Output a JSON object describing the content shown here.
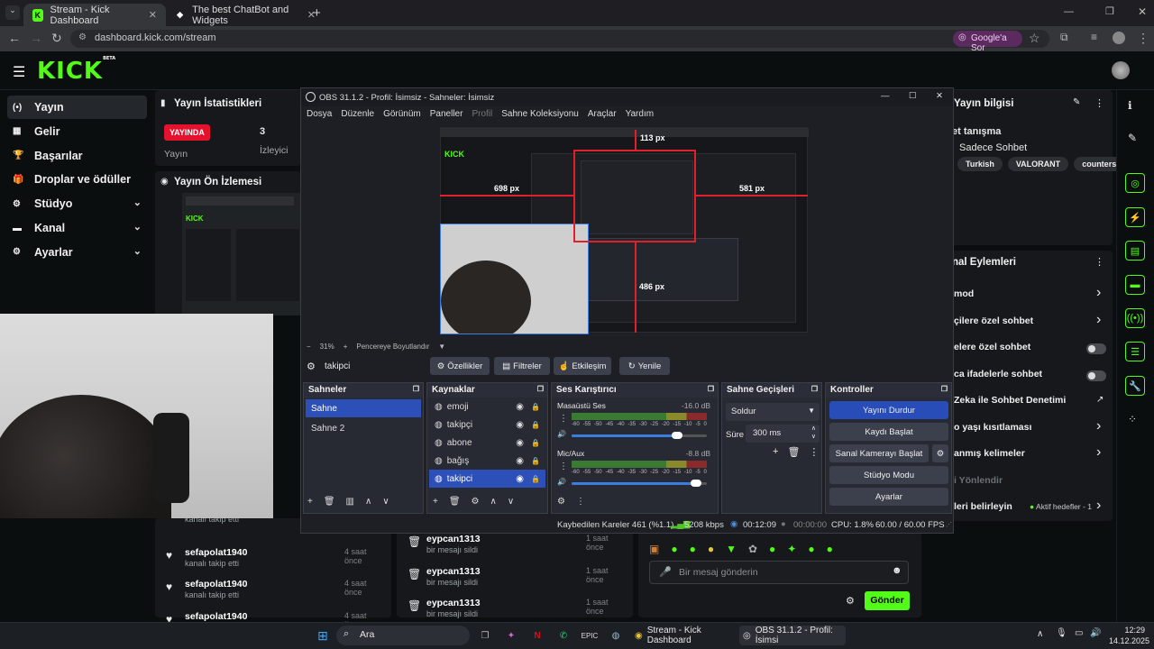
{
  "browser": {
    "tabs": [
      {
        "title": "Stream - Kick Dashboard",
        "active": true
      },
      {
        "title": "The best ChatBot and Widgets",
        "active": false
      }
    ],
    "url": "dashboard.kick.com/stream",
    "google_btn": "Google'a Sor"
  },
  "kick": {
    "logo": "KICK",
    "logo_sup": "BETA",
    "sidebar": [
      {
        "label": "Yayın",
        "icon": "broadcast-icon",
        "active": true,
        "expand": false
      },
      {
        "label": "Gelir",
        "icon": "money-icon",
        "active": false,
        "expand": false
      },
      {
        "label": "Başarılar",
        "icon": "trophy-icon",
        "active": false,
        "expand": false
      },
      {
        "label": "Droplar ve ödüller",
        "icon": "gift-icon",
        "active": false,
        "expand": false
      },
      {
        "label": "Stüdyo",
        "icon": "gear-icon",
        "active": false,
        "expand": true
      },
      {
        "label": "Kanal",
        "icon": "chat-icon",
        "active": false,
        "expand": true
      },
      {
        "label": "Ayarlar",
        "icon": "cog-icon",
        "active": false,
        "expand": true
      }
    ],
    "stats": {
      "title": "Yayın İstatistikleri",
      "live_badge": "YAYINDA",
      "live_label": "Yayın",
      "viewers_value": "3",
      "viewers_label": "İzleyici"
    },
    "preview_title": "Yayın Ön İzlemesi",
    "info_title": "Yayın bilgisi",
    "info_intro": "et tanışma",
    "info_category": "Sadece Sohbet",
    "tags": [
      "Turkish",
      "VALORANT",
      "counterstrike"
    ],
    "actions_title": "nal Eylemleri",
    "actions": [
      {
        "label": "mod",
        "control": "arrow"
      },
      {
        "label": "çilere özel sohbet",
        "control": "arrow"
      },
      {
        "label": "elere özel sohbet",
        "control": "toggle"
      },
      {
        "label": "ca ifadelerle sohbet",
        "control": "toggle"
      },
      {
        "label": "Zeka ile Sohbet Denetimi",
        "control": "link"
      },
      {
        "label": "o yaşı kısıtlaması",
        "control": "arrow"
      },
      {
        "label": "anmış kelimeler",
        "control": "arrow"
      },
      {
        "label": "i Yönlendir",
        "control": "none"
      },
      {
        "label": "leri belirleyin",
        "control": "arrow",
        "extra": "Aktif hedefler - 1"
      }
    ],
    "feed_left": [
      {
        "name": "kanalı takip etti",
        "time": ""
      },
      {
        "name": "sefapolat1940",
        "sub": "kanalı takip etti",
        "time": "4 saat önce"
      },
      {
        "name": "sefapolat1940",
        "sub": "kanalı takip etti",
        "time": "4 saat önce"
      },
      {
        "name": "sefapolat1940",
        "sub": "kanalı takip etti",
        "time": "4 saat önce"
      }
    ],
    "feed_mid": [
      {
        "name": "eypcan1313",
        "sub": "bir mesajı sildi",
        "time": "1 saat önce"
      },
      {
        "name": "eypcan1313",
        "sub": "bir mesajı sildi",
        "time": "1 saat önce"
      },
      {
        "name": "eypcan1313",
        "sub": "bir mesajı sildi",
        "time": "1 saat önce"
      }
    ],
    "chat_placeholder": "Bir mesaj gönderin",
    "send_label": "Gönder"
  },
  "obs": {
    "title": "OBS 31.1.2 - Profil: İsimsiz - Sahneler: İsimsiz",
    "menu": [
      "Dosya",
      "Düzenle",
      "Görünüm",
      "Paneller",
      "Profil",
      "Sahne Koleksiyonu",
      "Araçlar",
      "Yardım"
    ],
    "measures": [
      "113 px",
      "698 px",
      "581 px",
      "486 px"
    ],
    "zoom": "31%",
    "fit_label": "Pencereye Boyutlandır",
    "source_name": "takipci",
    "toolbar": [
      "Özellikler",
      "Filtreler",
      "Etkileşim",
      "Yenile"
    ],
    "scenes_title": "Sahneler",
    "scenes": [
      "Sahne",
      "Sahne 2"
    ],
    "sources_title": "Kaynaklar",
    "sources": [
      "emoji",
      "takipçi",
      "abone",
      "bağış",
      "takipci"
    ],
    "mixer_title": "Ses Karıştırıcı",
    "mixer": [
      {
        "name": "Masaüstü Ses",
        "db": "-16.0 dB",
        "level": 0.78
      },
      {
        "name": "Mic/Aux",
        "db": "-8.8 dB",
        "level": 0.92
      }
    ],
    "meter_ticks": [
      "-60",
      "-55",
      "-50",
      "-45",
      "-40",
      "-35",
      "-30",
      "-25",
      "-20",
      "-15",
      "-10",
      "-5",
      "0"
    ],
    "transitions_title": "Sahne Geçişleri",
    "transition": "Soldur",
    "duration_label": "Süre",
    "duration": "300 ms",
    "controls_title": "Kontroller",
    "controls": [
      "Yayını Durdur",
      "Kaydı Başlat",
      "Sanal Kamerayı Başlat",
      "Stüdyo Modu",
      "Ayarlar"
    ],
    "status": {
      "dropped": "Kaybedilen Kareler 461 (%1.1)",
      "bitrate": "5208 kbps",
      "live_time": "00:12:09",
      "rec_time": "00:00:00",
      "cpu": "CPU: 1.8%",
      "fps": "60.00 / 60.00 FPS"
    }
  },
  "taskbar": {
    "search": "Ara",
    "apps": [
      "Stream - Kick Dashboard",
      "OBS 31.1.2 - Profil: İsimsi"
    ],
    "time": "12:29",
    "date": "14.12.2025"
  }
}
